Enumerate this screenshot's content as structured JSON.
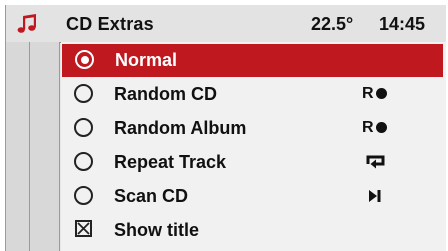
{
  "header": {
    "icon": "music-note-icon",
    "title": "CD Extras",
    "temperature": "22.5°",
    "time": "14:45"
  },
  "colors": {
    "accent": "#c0181f",
    "icon_red": "#c0181f"
  },
  "menu": {
    "items": [
      {
        "label": "Normal",
        "selected": true,
        "control": "radio",
        "checked": true,
        "indicator": null
      },
      {
        "label": "Random CD",
        "selected": false,
        "control": "radio",
        "checked": false,
        "indicator": "random-icon",
        "indicator_text": "R"
      },
      {
        "label": "Random Album",
        "selected": false,
        "control": "radio",
        "checked": false,
        "indicator": "random-icon",
        "indicator_text": "R"
      },
      {
        "label": "Repeat Track",
        "selected": false,
        "control": "radio",
        "checked": false,
        "indicator": "repeat-icon"
      },
      {
        "label": "Scan CD",
        "selected": false,
        "control": "radio",
        "checked": false,
        "indicator": "scan-skip-icon"
      },
      {
        "label": "Show title",
        "selected": false,
        "control": "checkbox",
        "checked": true,
        "indicator": null
      }
    ]
  }
}
